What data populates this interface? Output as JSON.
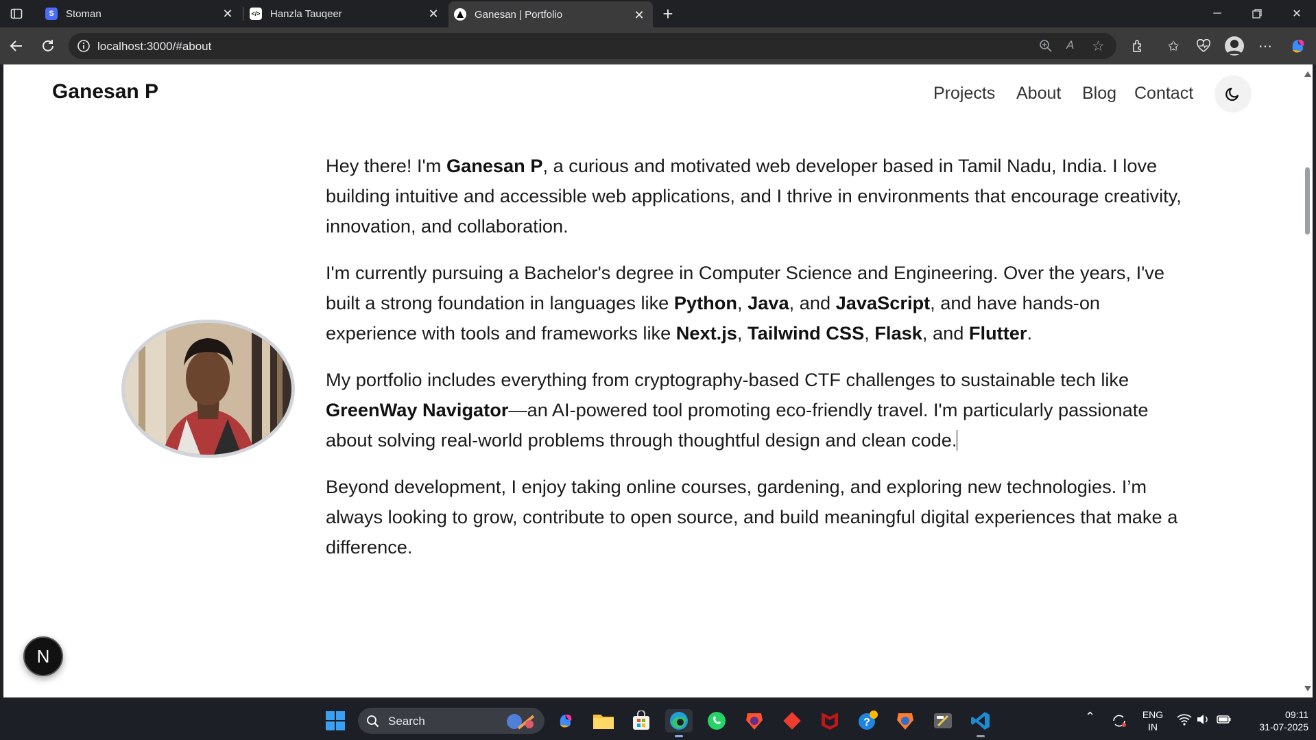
{
  "tabs": [
    {
      "title": "Stoman",
      "icon": "stoman-favicon"
    },
    {
      "title": "Hanzla Tauqeer",
      "icon": "code-favicon"
    },
    {
      "title": "Ganesan | Portfolio",
      "icon": "triangle-favicon",
      "active": true
    }
  ],
  "address": {
    "url": "localhost:3000/#about"
  },
  "site": {
    "brand": "Ganesan P",
    "nav": [
      "Projects",
      "About",
      "Blog",
      "Contact"
    ]
  },
  "about": {
    "p1": {
      "a": "Hey there! I'm ",
      "b": "Ganesan P",
      "c": ", a curious and motivated web developer based in Tamil Nadu, India. I love building intuitive and accessible web applications, and I thrive in environments that encourage creativity, innovation, and collaboration."
    },
    "p2": {
      "a": "I'm currently pursuing a Bachelor's degree in Computer Science and Engineering. Over the years, I've built a strong foundation in languages like ",
      "python": "Python",
      "s1": ", ",
      "java": "Java",
      "s2": ", and ",
      "js": "JavaScript",
      "s3": ", and have hands-on experience with tools and frameworks like ",
      "next": "Next.js",
      "s4": ", ",
      "tailwind": "Tailwind CSS",
      "s5": ", ",
      "flask": "Flask",
      "s6": ", and ",
      "flutter": "Flutter",
      "s7": "."
    },
    "p3": {
      "a": "My portfolio includes everything from cryptography-based CTF challenges to sustainable tech like ",
      "b": "GreenWay Navigator",
      "c": "—an AI-powered tool promoting eco-friendly travel. I'm particularly passionate about solving real-world problems through thoughtful design and clean code."
    },
    "p4": "Beyond development, I enjoy taking online courses, gardening, and exploring new technologies. I’m always looking to grow, contribute to open source, and build meaningful digital experiences that make a difference."
  },
  "dev_badge": "N",
  "taskbar": {
    "search_placeholder": "Search",
    "lang": "ENG",
    "region": "IN",
    "time": "09:11",
    "date": "31-07-2025"
  }
}
